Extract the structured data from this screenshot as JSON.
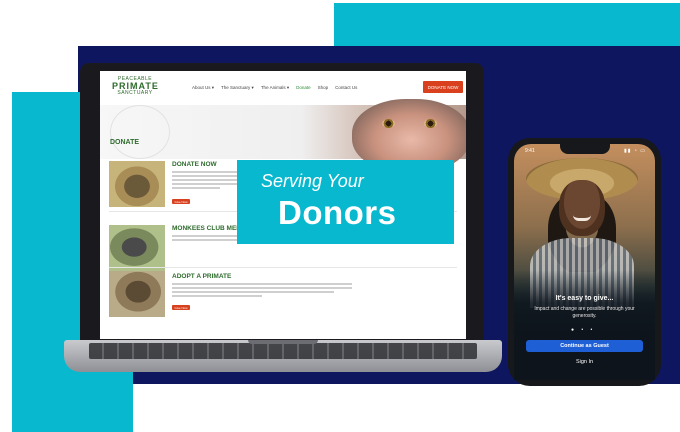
{
  "site": {
    "logo_line1": "PEACEABLE",
    "logo_line2": "PRIMATE",
    "logo_line3": "SANCTUARY",
    "nav": [
      "About Us ▾",
      "The Sanctuary ▾",
      "The Animals ▾",
      "Donate",
      "Shop",
      "Contact Us"
    ],
    "donate_button": "DONATE NOW",
    "page_heading": "DONATE",
    "programs": [
      {
        "title": "DONATE NOW",
        "button": "Give Now"
      },
      {
        "title": "MONKEES CLUB MEMBER",
        "button": ""
      },
      {
        "title": "ADOPT A PRIMATE",
        "button": "Give Now"
      }
    ]
  },
  "overlay": {
    "line1": "Serving Your",
    "line2": "Donors"
  },
  "phone": {
    "time": "9:41",
    "status_icons": "▮▮ ◔ ▭",
    "heading": "It's easy to give...",
    "subtext": "Impact and change are possible through your generosity.",
    "pager_dots": "● • •",
    "primary_button": "Continue as Guest",
    "secondary_link": "Sign In"
  },
  "colors": {
    "teal": "#07b8cf",
    "navy": "#0f1660",
    "brand_green": "#2e6b2c",
    "donate_orange": "#d9411e",
    "guest_blue": "#1f5fd6"
  }
}
